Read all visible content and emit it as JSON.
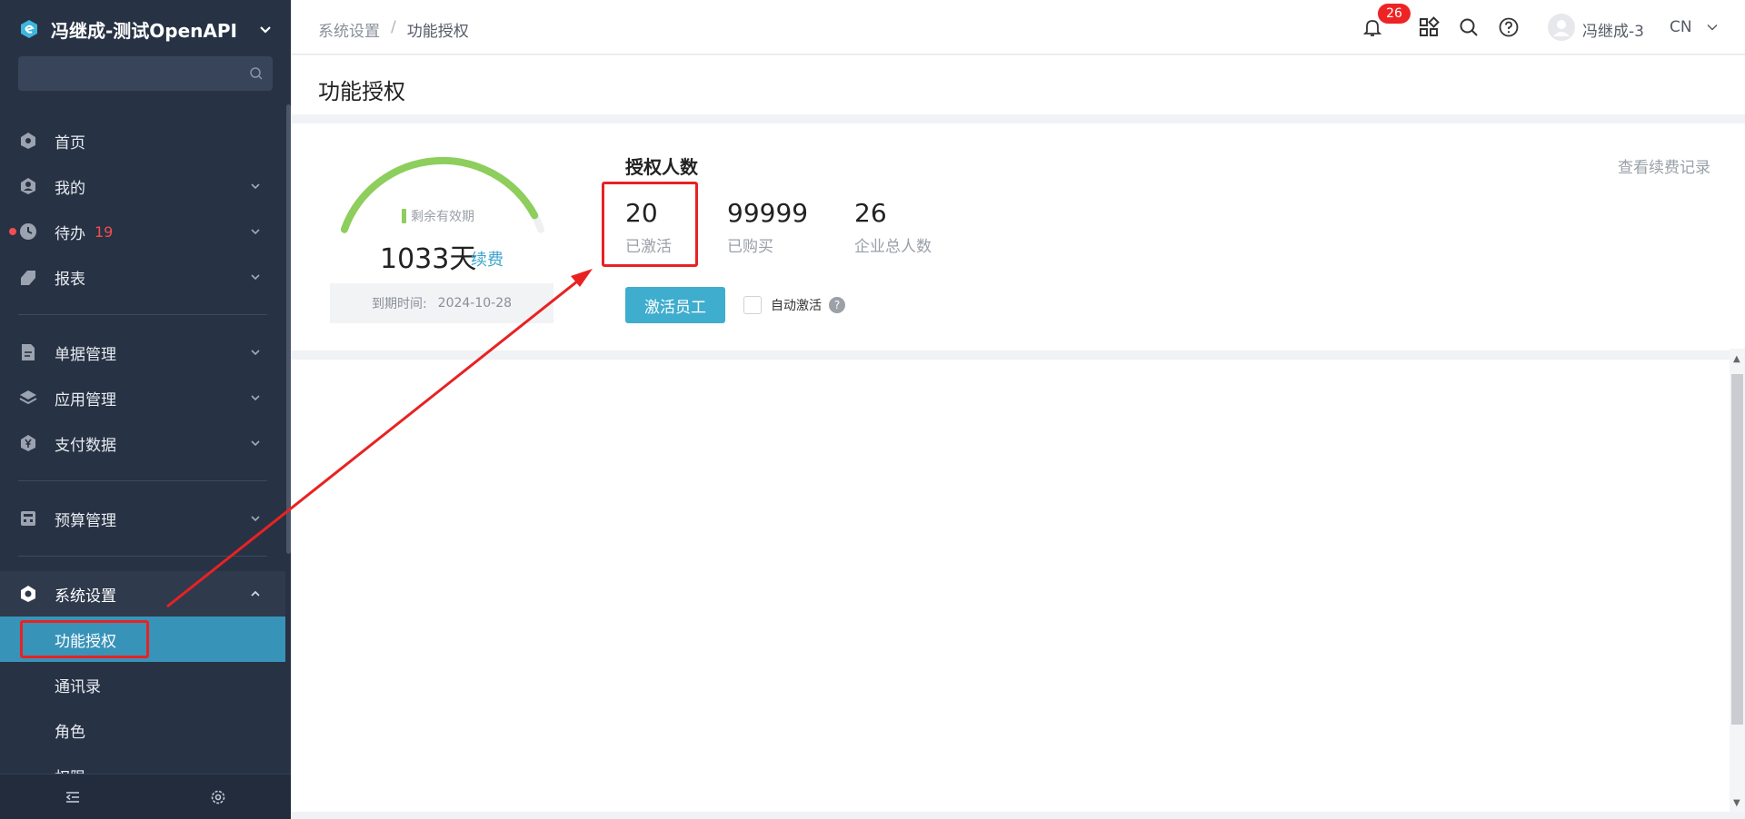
{
  "sidebar": {
    "brand_name": "冯继成-测试OpenAPI",
    "search_placeholder": "",
    "items": [
      {
        "label": "首页"
      },
      {
        "label": "我的"
      },
      {
        "label": "待办",
        "count": "19"
      },
      {
        "label": "报表"
      },
      {
        "label": "单据管理"
      },
      {
        "label": "应用管理"
      },
      {
        "label": "支付数据"
      },
      {
        "label": "预算管理"
      },
      {
        "label": "系统设置"
      }
    ],
    "sub_items": [
      {
        "label": "功能授权"
      },
      {
        "label": "通讯录"
      },
      {
        "label": "角色"
      },
      {
        "label": "权限"
      }
    ]
  },
  "header": {
    "breadcrumb": [
      "系统设置",
      "功能授权"
    ],
    "notification_count": "26",
    "username": "冯继成-3",
    "language": "CN"
  },
  "page": {
    "title": "功能授权"
  },
  "license": {
    "remaining_label": "剩余有效期",
    "remaining_days": "1033天",
    "renew_label": "续费",
    "expiry_label": "到期时间:",
    "expiry_date": "2024-10-28",
    "section_title": "授权人数",
    "stats": [
      {
        "value": "20",
        "label": "已激活"
      },
      {
        "value": "99999",
        "label": "已购买"
      },
      {
        "value": "26",
        "label": "企业总人数"
      }
    ],
    "activate_button": "激活员工",
    "auto_activate_label": "自动激活",
    "auto_activate_checked": false,
    "renewal_history_link": "查看续费记录",
    "gauge_fraction": 0.94
  },
  "colors": {
    "sidebar_bg": "#273244",
    "active_item": "#3893b8",
    "accent": "#3fadcd",
    "gauge": "#8dce5c",
    "annotation": "#e82222",
    "badge": "#ee2424"
  }
}
